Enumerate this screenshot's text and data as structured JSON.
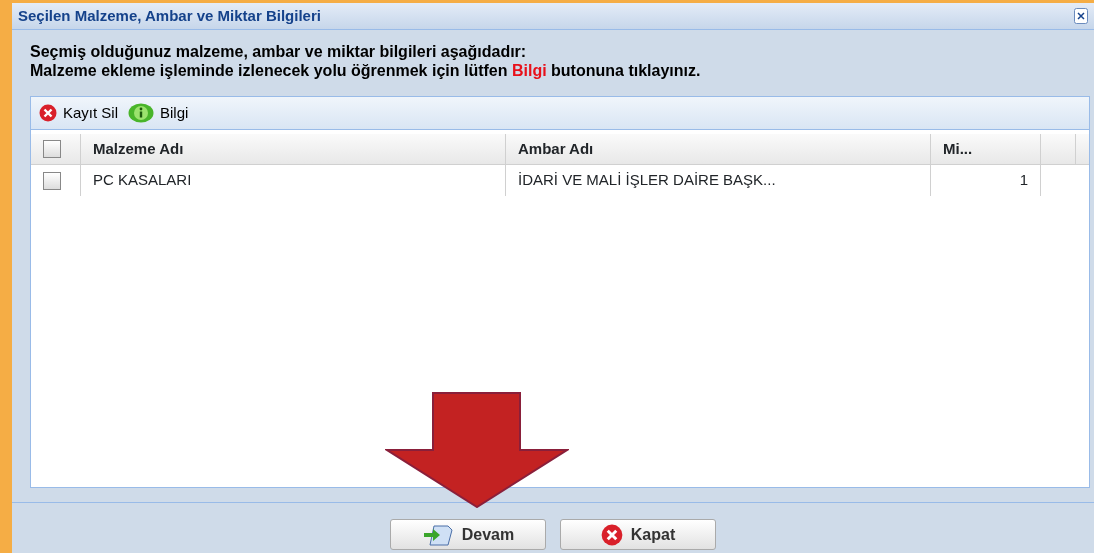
{
  "window": {
    "title": "Seçilen Malzeme, Ambar ve Miktar Bilgileri"
  },
  "instructions": {
    "line1": "Seçmiş olduğunuz malzeme, ambar ve miktar bilgileri aşağıdadır:",
    "line2_before": "Malzeme ekleme işleminde izlenecek yolu öğrenmek için lütfen",
    "line2_highlight": "Bilgi",
    "line2_after": "butonuna tıklayınız."
  },
  "toolbar": [
    {
      "label": "Kayıt Sil",
      "kind": "delete"
    },
    {
      "label": "Bilgi",
      "kind": "info"
    }
  ],
  "table": {
    "header_checked": false,
    "columns": [
      "Malzeme Adı",
      "Ambar Adı",
      "Mi..."
    ],
    "rows": [
      {
        "checked": false,
        "cells": [
          "PC KASALARI",
          "İDARİ VE MALİ İŞLER DAİRE BAŞK...",
          "1"
        ]
      }
    ]
  },
  "buttons": [
    {
      "label": "Devam",
      "kind": "continue"
    },
    {
      "label": "Kapat",
      "kind": "close"
    }
  ]
}
